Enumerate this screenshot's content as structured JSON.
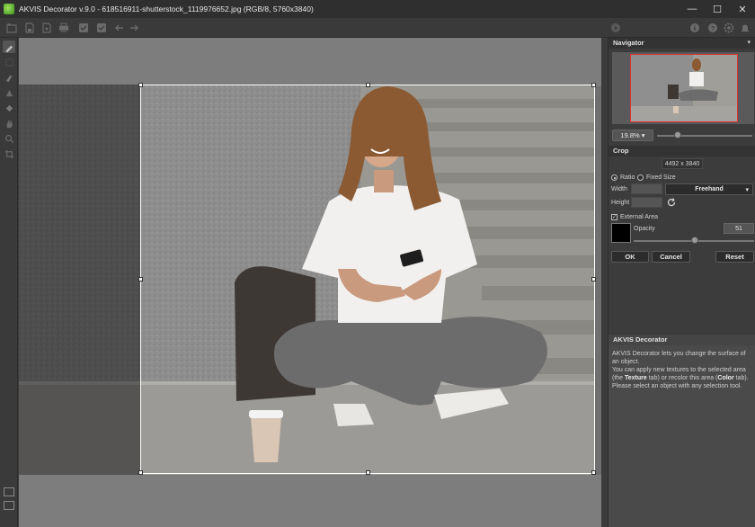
{
  "window": {
    "title": "AKVIS Decorator v.9.0 - 618516911-shutterstock_1119976652.jpg (RGB/8, 5760x3840)",
    "minimize": "—",
    "maximize": "☐",
    "close": "✕"
  },
  "toolbar": {
    "left_icons": [
      "open-icon",
      "save-icon",
      "save-as-icon",
      "print-icon",
      "share-icon",
      "apply-icon",
      "undo-icon",
      "redo-icon"
    ],
    "right_icons": [
      "run-icon",
      "info-icon",
      "help-icon",
      "settings-icon",
      "notifications-icon"
    ]
  },
  "tools": [
    "selection-brush-icon",
    "eraser-icon",
    "recolor-brush-icon",
    "magic-brush-icon",
    "bucket-icon",
    "hand-icon",
    "zoom-icon",
    "crop-icon"
  ],
  "navigator": {
    "title": "Navigator",
    "zoom": "19.8%",
    "zoom_level": 0.22
  },
  "crop": {
    "title": "Crop",
    "size": "4492 x 3840",
    "ratio_label": "Ratio",
    "fixed_size_label": "Fixed Size",
    "ratio_selected": true,
    "width_label": "Width",
    "height_label": "Height",
    "preset": "Freehand",
    "external_area_label": "External Area",
    "external_area_checked": true,
    "opacity_label": "Opacity",
    "opacity": "51",
    "opacity_level": 0.51,
    "color": "#000000",
    "ok": "OK",
    "cancel": "Cancel",
    "reset": "Reset"
  },
  "info": {
    "title": "AKVIS Decorator",
    "line1": "AKVIS Decorator lets you change the surface of an object.",
    "line2_a": "You can apply new textures to the selected area (the ",
    "line2_b": "Texture",
    "line2_c": " tab) or recolor this area (",
    "line2_d": "Color",
    "line2_e": " tab).",
    "line3": "Please select an object with any selection tool."
  },
  "colors": {
    "frame": "#ffffff",
    "navigator_rect": "#dd3333"
  }
}
